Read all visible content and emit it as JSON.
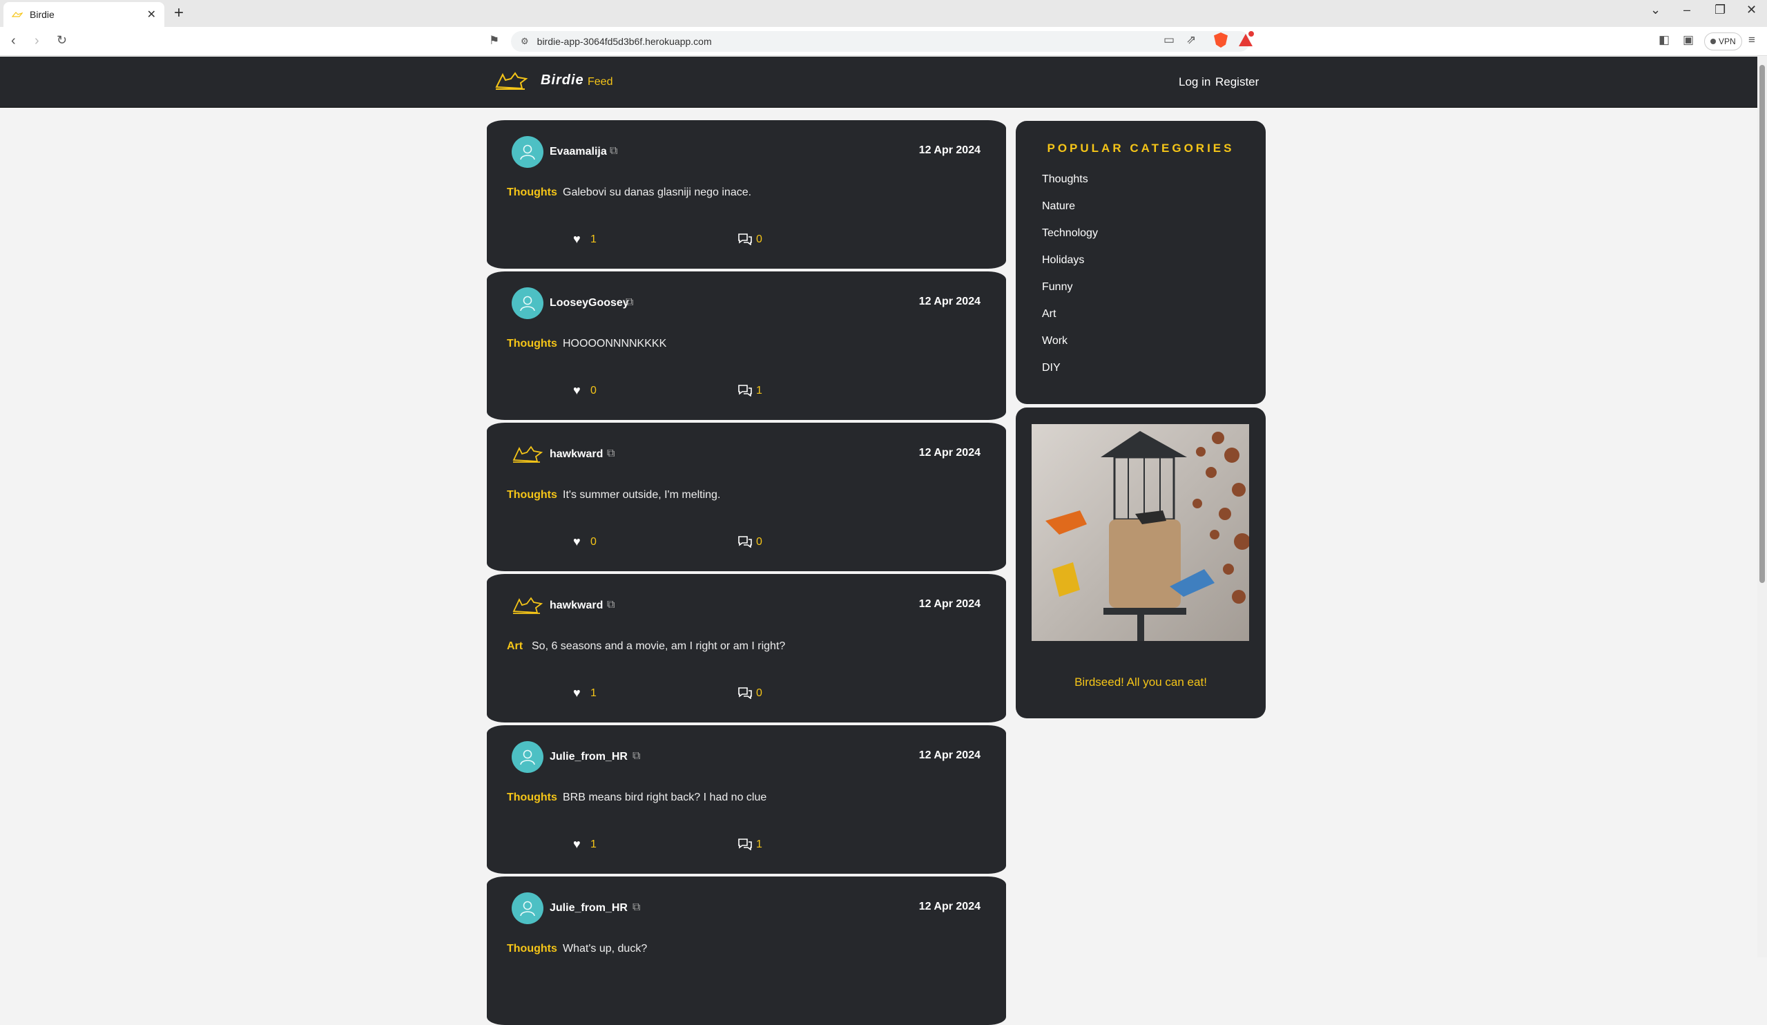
{
  "browser": {
    "tab_title": "Birdie",
    "url": "birdie-app-3064fd5d3b6f.herokuapp.com",
    "vpn_label": "VPN",
    "rewards_badge": "1"
  },
  "header": {
    "brand": "Birdie",
    "nav_feed": "Feed",
    "login": "Log in",
    "register": "Register"
  },
  "posts": [
    {
      "username": "Evaamalija",
      "date": "12 Apr 2024",
      "category": "Thoughts",
      "content": "Galebovi su danas glasniji nego inace.",
      "likes": "1",
      "comments": "0",
      "avatar": "person-icon"
    },
    {
      "username": "LooseyGoosey",
      "date": "12 Apr 2024",
      "category": "Thoughts",
      "content": "HOOOONNNNKKKK",
      "likes": "0",
      "comments": "1",
      "avatar": "person-icon"
    },
    {
      "username": "hawkward",
      "date": "12 Apr 2024",
      "category": "Thoughts",
      "content": "It's summer outside, I'm melting.",
      "likes": "0",
      "comments": "0",
      "avatar": "bird-icon"
    },
    {
      "username": "hawkward",
      "date": "12 Apr 2024",
      "category": "Art",
      "content": "So, 6 seasons and a movie, am I right or am I right?",
      "likes": "1",
      "comments": "0",
      "avatar": "bird-icon"
    },
    {
      "username": "Julie_from_HR",
      "date": "12 Apr 2024",
      "category": "Thoughts",
      "content": "BRB means bird right back? I had no clue",
      "likes": "1",
      "comments": "1",
      "avatar": "person-icon"
    },
    {
      "username": "Julie_from_HR",
      "date": "12 Apr 2024",
      "category": "Thoughts",
      "content": "What's up, duck?",
      "likes": "",
      "comments": "",
      "avatar": "person-icon"
    }
  ],
  "sidebar": {
    "title": "POPULAR CATEGORIES",
    "categories": [
      "Thoughts",
      "Nature",
      "Technology",
      "Holidays",
      "Funny",
      "Art",
      "Work",
      "DIY"
    ]
  },
  "ad": {
    "text": "Birdseed! All you can eat!",
    "image": "bird-feeder-photo"
  },
  "colors": {
    "accent": "#f5c518",
    "card": "#26282c",
    "avatar": "#4dc0c4",
    "background": "#f3f3f3"
  }
}
